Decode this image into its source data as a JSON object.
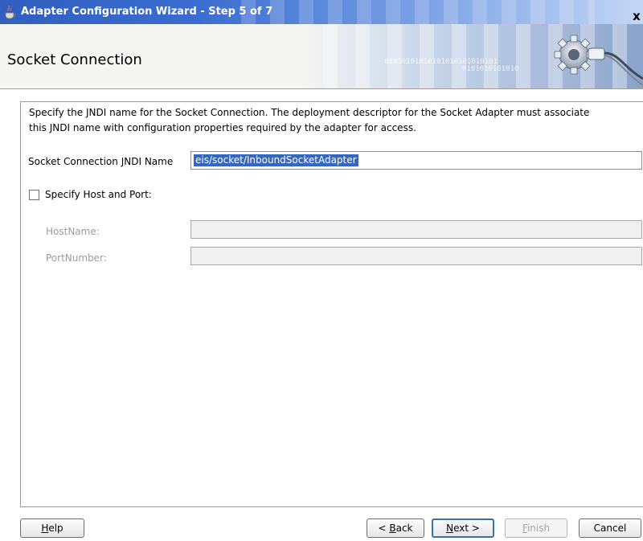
{
  "window": {
    "title": "Adapter Configuration Wizard - Step 5 of 7",
    "close_glyph": "x"
  },
  "header": {
    "title": "Socket Connection",
    "binary_text_1": "01010101010101010101010101",
    "binary_text_2": "0101010101010"
  },
  "description": {
    "line1": "Specify the JNDI name for the Socket Connection.  The deployment descriptor for the Socket Adapter must associate",
    "line2": "this JNDI name with configuration properties required by the adapter for access."
  },
  "form": {
    "jndi": {
      "label_pre": "Socket Connection ",
      "label_mnemonic": "J",
      "label_post": "NDI Name",
      "value": "eis/socket/InboundSocketAdapter",
      "selected": true
    },
    "specify_host_port": {
      "label": "Specify Host and Port:",
      "checked": false
    },
    "hostname": {
      "label": "HostName:",
      "value": "",
      "enabled": false
    },
    "portnumber": {
      "label": "PortNumber:",
      "value": "",
      "enabled": false
    }
  },
  "buttons": {
    "help": {
      "pre": "",
      "mnemonic": "H",
      "post": "elp"
    },
    "back": {
      "pre": "< ",
      "mnemonic": "B",
      "post": "ack"
    },
    "next": {
      "pre": "",
      "mnemonic": "N",
      "post": "ext >"
    },
    "finish": {
      "pre": "",
      "mnemonic": "F",
      "post": "inish",
      "enabled": false
    },
    "cancel": {
      "label": "Cancel"
    }
  },
  "colors": {
    "titlebar": "#2f5fbf",
    "selection": "#3168c6",
    "default_button_border": "#3a6fb5"
  },
  "icons": {
    "app": "java-cup-icon",
    "banner": "gear-plug-icon",
    "close": "close-icon"
  }
}
